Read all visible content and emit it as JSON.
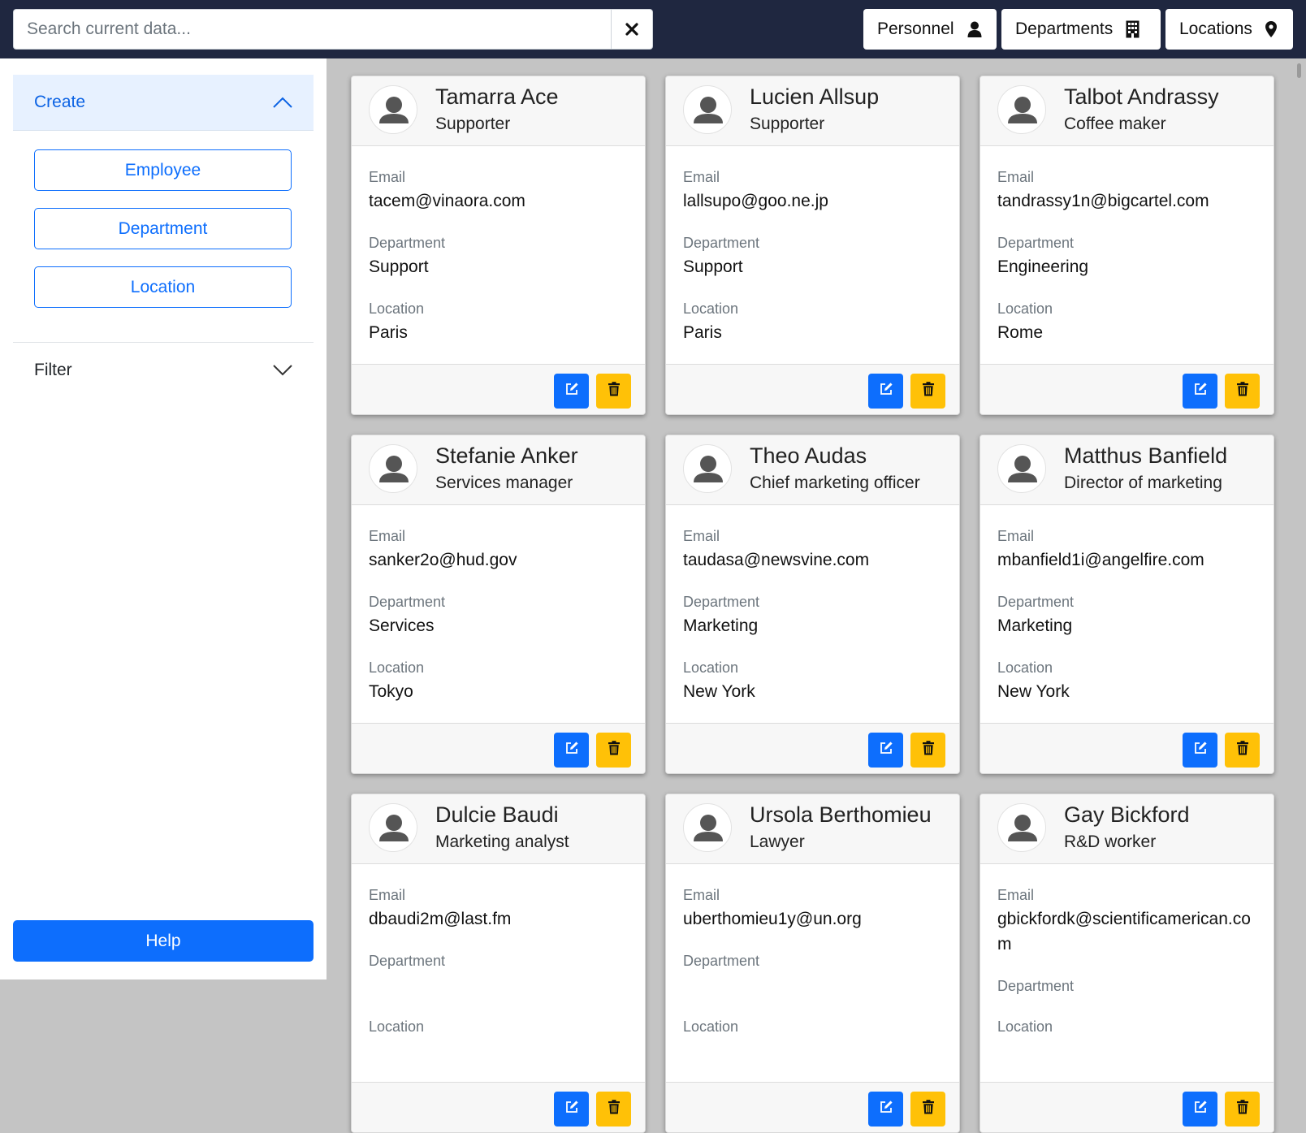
{
  "search": {
    "placeholder": "Search current data..."
  },
  "nav": {
    "personnel": "Personnel",
    "departments": "Departments",
    "locations": "Locations"
  },
  "sidebar": {
    "create_label": "Create",
    "create_items": [
      "Employee",
      "Department",
      "Location"
    ],
    "filter_label": "Filter",
    "help_label": "Help"
  },
  "labels": {
    "email": "Email",
    "department": "Department",
    "location": "Location"
  },
  "colors": {
    "navbar": "#1f2740",
    "primary": "#0d6efd",
    "warning": "#ffc107",
    "accordion_active": "#e7f1ff"
  },
  "employees": [
    {
      "name": "Tamarra Ace",
      "job": "Supporter",
      "email": "tacem@vinaora.com",
      "department": "Support",
      "location": "Paris"
    },
    {
      "name": "Lucien Allsup",
      "job": "Supporter",
      "email": "lallsupo@goo.ne.jp",
      "department": "Support",
      "location": "Paris"
    },
    {
      "name": "Talbot Andrassy",
      "job": "Coffee maker",
      "email": "tandrassy1n@bigcartel.com",
      "department": "Engineering",
      "location": "Rome"
    },
    {
      "name": "Stefanie Anker",
      "job": "Services manager",
      "email": "sanker2o@hud.gov",
      "department": "Services",
      "location": "Tokyo"
    },
    {
      "name": "Theo Audas",
      "job": "Chief marketing officer",
      "email": "taudasa@newsvine.com",
      "department": "Marketing",
      "location": "New York"
    },
    {
      "name": "Matthus Banfield",
      "job": "Director of marketing",
      "email": "mbanfield1i@angelfire.com",
      "department": "Marketing",
      "location": "New York"
    },
    {
      "name": "Dulcie Baudi",
      "job": "Marketing analyst",
      "email": "dbaudi2m@last.fm",
      "department": "",
      "location": ""
    },
    {
      "name": "Ursola Berthomieu",
      "job": "Lawyer",
      "email": "uberthomieu1y@un.org",
      "department": "",
      "location": ""
    },
    {
      "name": "Gay Bickford",
      "job": "R&D worker",
      "email": "gbickfordk@scientificamerican.com",
      "department": "",
      "location": ""
    }
  ]
}
